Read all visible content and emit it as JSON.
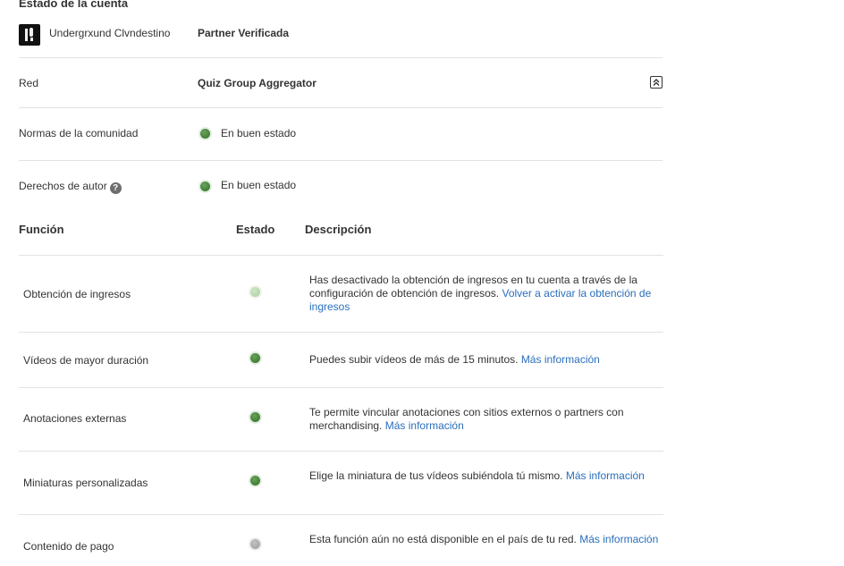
{
  "account_status": {
    "title": "Estado de la cuenta",
    "channel_name": "Undergrxund Clvndestino",
    "channel_status": "Partner Verificada",
    "network_label": "Red",
    "network_value": "Quiz Group Aggregator",
    "community_label": "Normas de la comunidad",
    "community_value": "En buen estado",
    "copyright_label": "Derechos de autor",
    "copyright_value": "En buen estado",
    "help_glyph": "?"
  },
  "features_table": {
    "headers": {
      "function": "Función",
      "status": "Estado",
      "description": "Descripción"
    },
    "rows": [
      {
        "name": "Obtención de ingresos",
        "status": "inactive",
        "description": "Has desactivado la obtención de ingresos en tu cuenta a través de la configuración de obtención de ingresos. ",
        "link": "Volver a activar la obtención de ingresos"
      },
      {
        "name": "Vídeos de mayor duración",
        "status": "enabled",
        "description": "Puedes subir vídeos de más de 15 minutos. ",
        "link": "Más información"
      },
      {
        "name": "Anotaciones externas",
        "status": "enabled",
        "description": "Te permite vincular anotaciones con sitios externos o partners con merchandising. ",
        "link": "Más información"
      },
      {
        "name": "Miniaturas personalizadas",
        "status": "enabled",
        "description": "Elige la miniatura de tus vídeos subiéndola tú mismo. ",
        "link": "Más información"
      },
      {
        "name": "Contenido de pago",
        "status": "unavailable",
        "description": "Esta función aún no está disponible en el país de tu red. ",
        "link": "Más información"
      }
    ]
  },
  "colors": {
    "status_green": "#3f7f35",
    "status_light_green": "#b4d6a8",
    "status_gray": "#a8a8a8",
    "link_blue": "#2a6ebb",
    "divider": "#e2e2e2"
  },
  "icons": {
    "collapse": "collapse-chevrons-up-icon",
    "help": "question-mark-icon",
    "avatar": "channel-logo-icon"
  }
}
